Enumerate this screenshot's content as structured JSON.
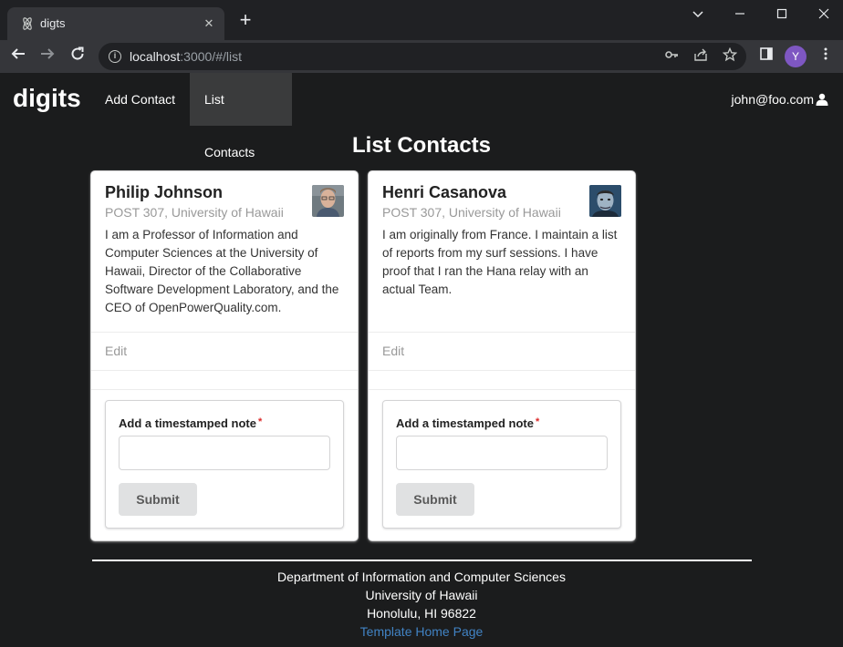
{
  "browser": {
    "tab_title": "digts",
    "url_host": "localhost",
    "url_path": ":3000/#/list",
    "avatar_initial": "Y"
  },
  "navbar": {
    "brand": "digits",
    "items": [
      {
        "label": "Add Contact"
      },
      {
        "label": "List Contacts",
        "active": true
      }
    ],
    "user": "john@foo.com"
  },
  "page": {
    "title": "List Contacts"
  },
  "contacts": [
    {
      "name": "Philip Johnson",
      "address": "POST 307, University of Hawaii",
      "description": "I am a Professor of Information and Computer Sciences at the University of Hawaii, Director of the Collaborative Software Development Laboratory, and the CEO of OpenPowerQuality.com.",
      "edit_label": "Edit",
      "note_label": "Add a timestamped note",
      "required_mark": "*",
      "submit_label": "Submit"
    },
    {
      "name": "Henri Casanova",
      "address": "POST 307, University of Hawaii",
      "description": "I am originally from France. I maintain a list of reports from my surf sessions. I have proof that I ran the Hana relay with an actual Team.",
      "edit_label": "Edit",
      "note_label": "Add a timestamped note",
      "required_mark": "*",
      "submit_label": "Submit"
    }
  ],
  "footer": {
    "line1": "Department of Information and Computer Sciences",
    "line2": "University of Hawaii",
    "line3": "Honolulu, HI 96822",
    "link": "Template Home Page"
  },
  "colors": {
    "background": "#1b1c1d",
    "link": "#4183c4",
    "avatar": "#7e57c2"
  }
}
